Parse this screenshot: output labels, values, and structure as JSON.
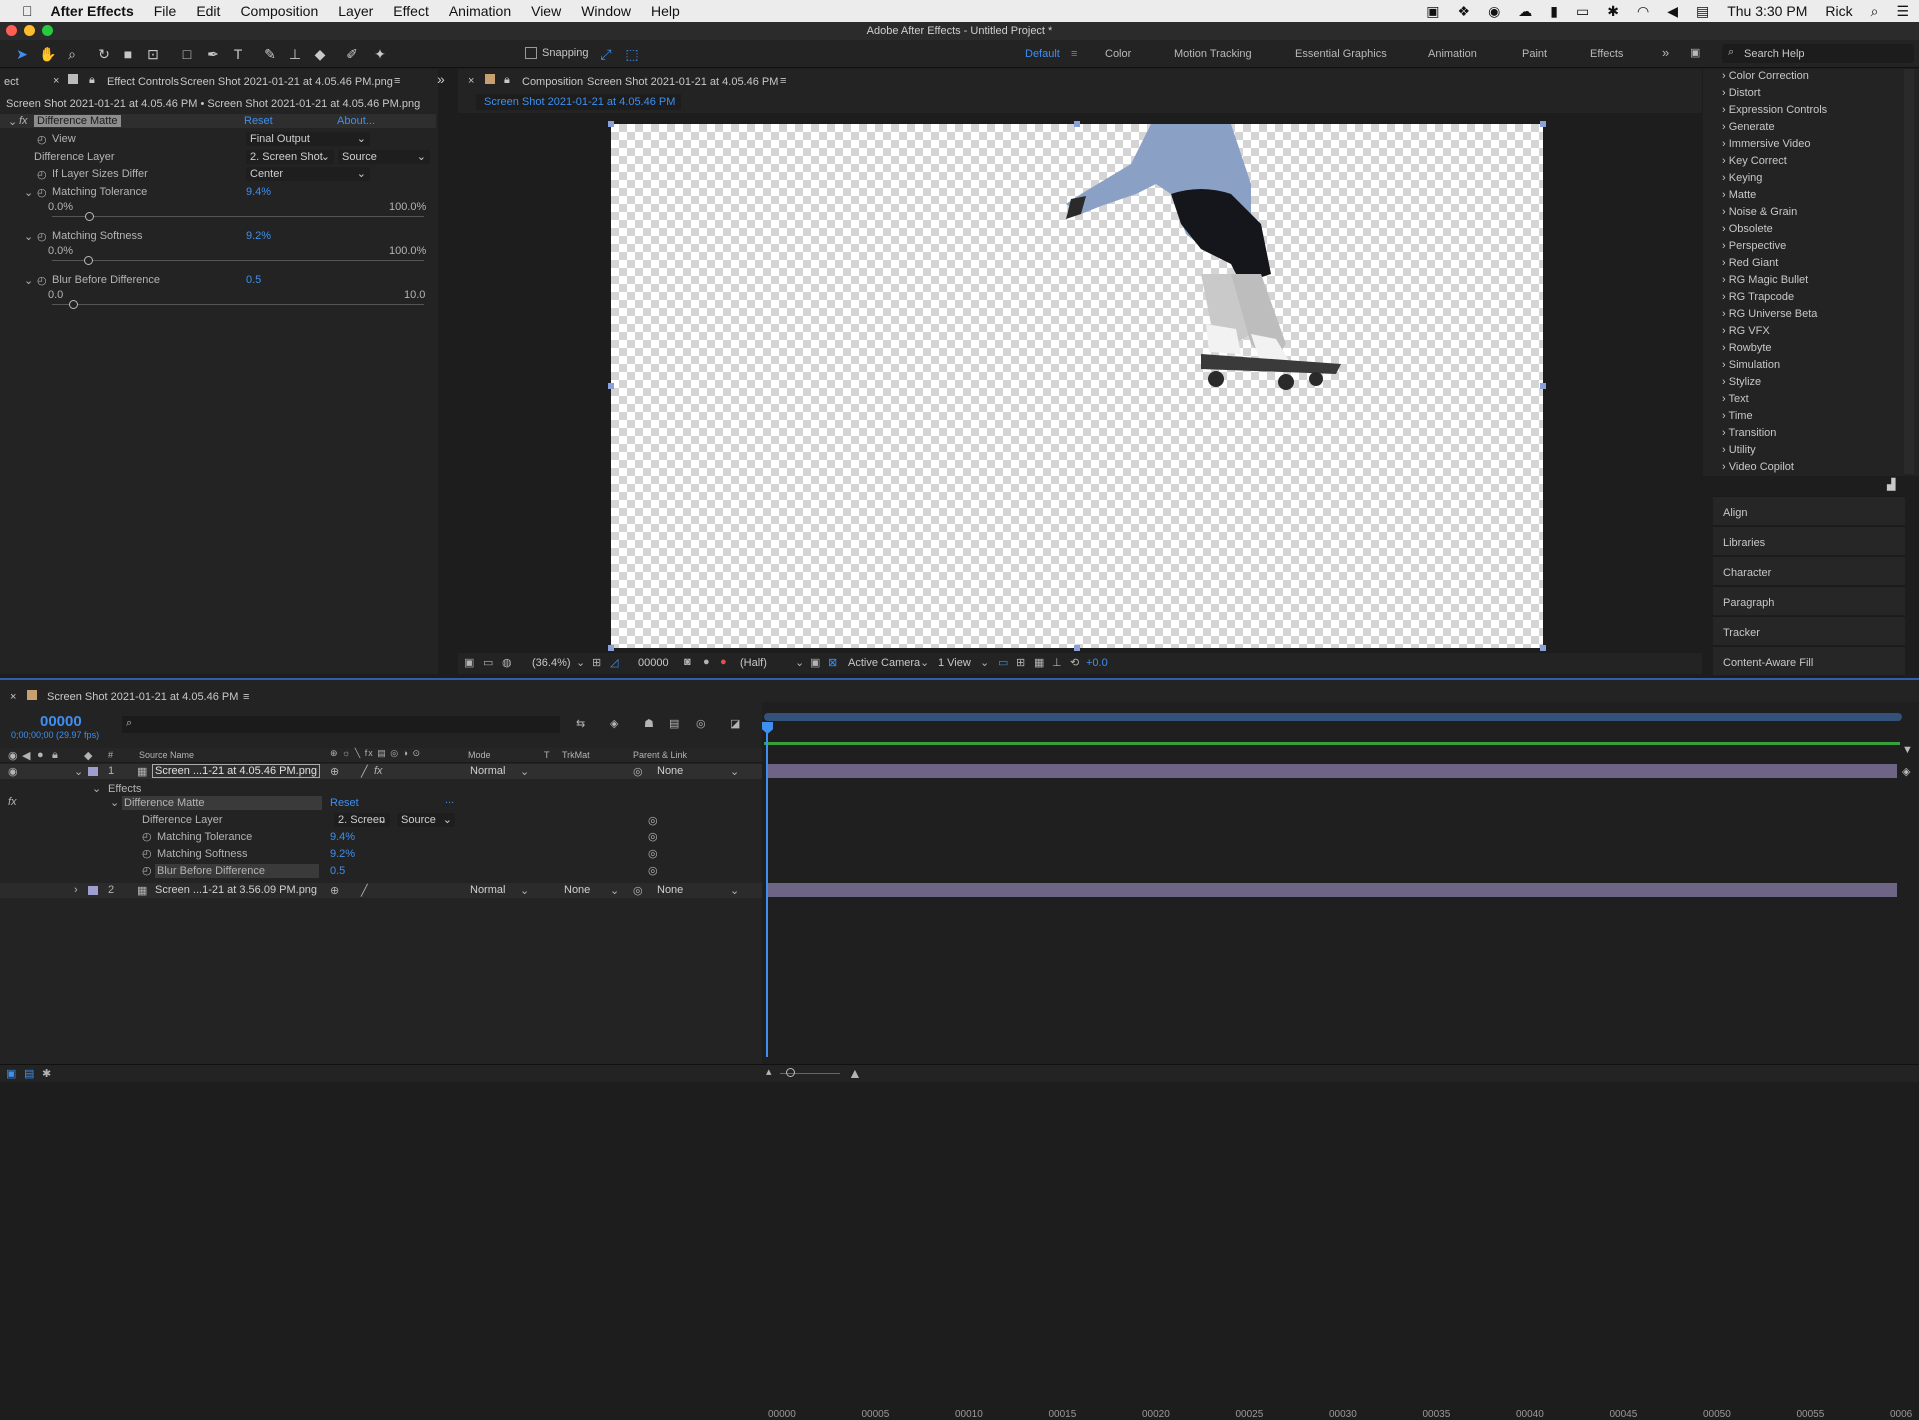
{
  "menubar": {
    "app_name": "After Effects",
    "items": [
      "File",
      "Edit",
      "Composition",
      "Layer",
      "Effect",
      "Animation",
      "View",
      "Window",
      "Help"
    ],
    "clock": "Thu 3:30 PM",
    "user": "Rick"
  },
  "window_title": "Adobe After Effects - Untitled Project *",
  "toolbar": {
    "snapping_label": "Snapping",
    "workspaces": [
      "Default",
      "Color",
      "Motion Tracking",
      "Essential Graphics",
      "Animation",
      "Paint",
      "Effects"
    ],
    "active_workspace": "Default",
    "search_placeholder": "Search Help"
  },
  "effect_controls": {
    "left_tab_stub": "ect",
    "tab_label": "Effect Controls",
    "tab_file": "Screen Shot 2021-01-21 at 4.05.46 PM.png",
    "breadcrumb": "Screen Shot 2021-01-21 at 4.05.46 PM • Screen Shot 2021-01-21 at 4.05.46 PM.png",
    "effect_name": "Difference Matte",
    "reset": "Reset",
    "about": "About...",
    "view_label": "View",
    "view_value": "Final Output",
    "diff_layer_label": "Difference Layer",
    "diff_layer_value": "2. Screen Shot",
    "diff_layer_source": "Source",
    "if_sizes_label": "If Layer Sizes Differ",
    "if_sizes_value": "Center",
    "tol_label": "Matching Tolerance",
    "tol_value": "9.4%",
    "tol_min": "0.0%",
    "tol_max": "100.0%",
    "soft_label": "Matching Softness",
    "soft_value": "9.2%",
    "soft_min": "0.0%",
    "soft_max": "100.0%",
    "blur_label": "Blur Before Difference",
    "blur_value": "0.5",
    "blur_min": "0.0",
    "blur_max": "10.0"
  },
  "composition": {
    "tab_label": "Composition",
    "tab_name": "Screen Shot 2021-01-21 at 4.05.46 PM",
    "sub_tab": "Screen Shot 2021-01-21 at 4.05.46 PM",
    "zoom": "(36.4%)",
    "timecode": "00000",
    "resolution": "(Half)",
    "camera": "Active Camera",
    "views": "1 View",
    "exposure": "+0.0"
  },
  "effects_list": [
    "Color Correction",
    "Distort",
    "Expression Controls",
    "Generate",
    "Immersive Video",
    "Key Correct",
    "Keying",
    "Matte",
    "Noise & Grain",
    "Obsolete",
    "Perspective",
    "Red Giant",
    "RG Magic Bullet",
    "RG Trapcode",
    "RG Universe Beta",
    "RG VFX",
    "Rowbyte",
    "Simulation",
    "Stylize",
    "Text",
    "Time",
    "Transition",
    "Utility",
    "Video Copilot"
  ],
  "side_panels": [
    "Align",
    "Libraries",
    "Character",
    "Paragraph",
    "Tracker",
    "Content-Aware Fill"
  ],
  "timeline": {
    "tab_label": "Screen Shot 2021-01-21 at 4.05.46 PM",
    "timecode": "00000",
    "timecode_sub": "0;00;00;00 (29.97 fps)",
    "col_source": "Source Name",
    "col_mode": "Mode",
    "col_t": "T",
    "col_trkmat": "TrkMat",
    "col_parent": "Parent & Link",
    "col_hash": "#",
    "layer1_num": "1",
    "layer1_name": "Screen ...1-21 at 4.05.46 PM.png",
    "layer1_mode": "Normal",
    "layer1_parent": "None",
    "effects_label": "Effects",
    "effect_name": "Difference Matte",
    "effect_reset": "Reset",
    "effect_dots": "...",
    "diff_layer_label": "Difference Layer",
    "diff_layer_value": "2. Screen",
    "diff_layer_source": "Source",
    "tol_label": "Matching Tolerance",
    "tol_value": "9.4%",
    "soft_label": "Matching Softness",
    "soft_value": "9.2%",
    "blur_label": "Blur Before Difference",
    "blur_value": "0.5",
    "layer2_num": "2",
    "layer2_name": "Screen ...1-21 at 3.56.09 PM.png",
    "layer2_mode": "Normal",
    "layer2_trkmat": "None",
    "layer2_parent": "None",
    "ruler": [
      "00000",
      "00005",
      "00010",
      "00015",
      "00020",
      "00025",
      "00030",
      "00035",
      "00040",
      "00045",
      "00050",
      "00055",
      "0006"
    ]
  },
  "colors": {
    "accent": "#3e8ff0",
    "panel": "#232323",
    "layer_bar": "#6e6485"
  }
}
